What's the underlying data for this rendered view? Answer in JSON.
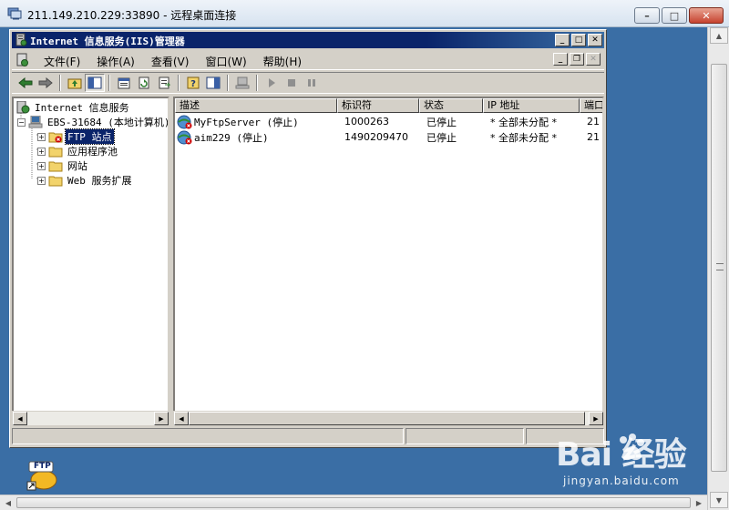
{
  "rdp": {
    "title": "211.149.210.229:33890 - 远程桌面连接"
  },
  "iis": {
    "title": "Internet 信息服务(IIS)管理器",
    "menu": [
      "文件(F)",
      "操作(A)",
      "查看(V)",
      "窗口(W)",
      "帮助(H)"
    ],
    "tree": {
      "root": "Internet 信息服务",
      "computer": "EBS-31684 (本地计算机)",
      "children": [
        "FTP 站点",
        "应用程序池",
        "网站",
        "Web 服务扩展"
      ]
    },
    "list": {
      "columns": [
        "描述",
        "标识符",
        "状态",
        "IP 地址",
        "端口"
      ],
      "rows": [
        {
          "desc": "MyFtpServer (停止)",
          "id": "1000263",
          "status": "已停止",
          "ip": "* 全部未分配 *",
          "port": "21"
        },
        {
          "desc": "aim229 (停止)",
          "id": "1490209470",
          "status": "已停止",
          "ip": "* 全部未分配 *",
          "port": "21"
        }
      ]
    }
  },
  "desktop": {
    "icon_text": "FTP"
  },
  "watermark": {
    "brand": "Bai 经验",
    "url": "jingyan.baidu.com"
  },
  "colors": {
    "desktop": "#3a6ea5",
    "title_active": "#0a246a",
    "chrome": "#d4d0c8",
    "stopped_red": "#cc0000"
  },
  "icons": [
    "computer-icon",
    "ftp-folder-icon",
    "folder-icon",
    "back-arrow-icon",
    "forward-arrow-icon",
    "play-icon",
    "stop-icon",
    "pause-icon"
  ]
}
